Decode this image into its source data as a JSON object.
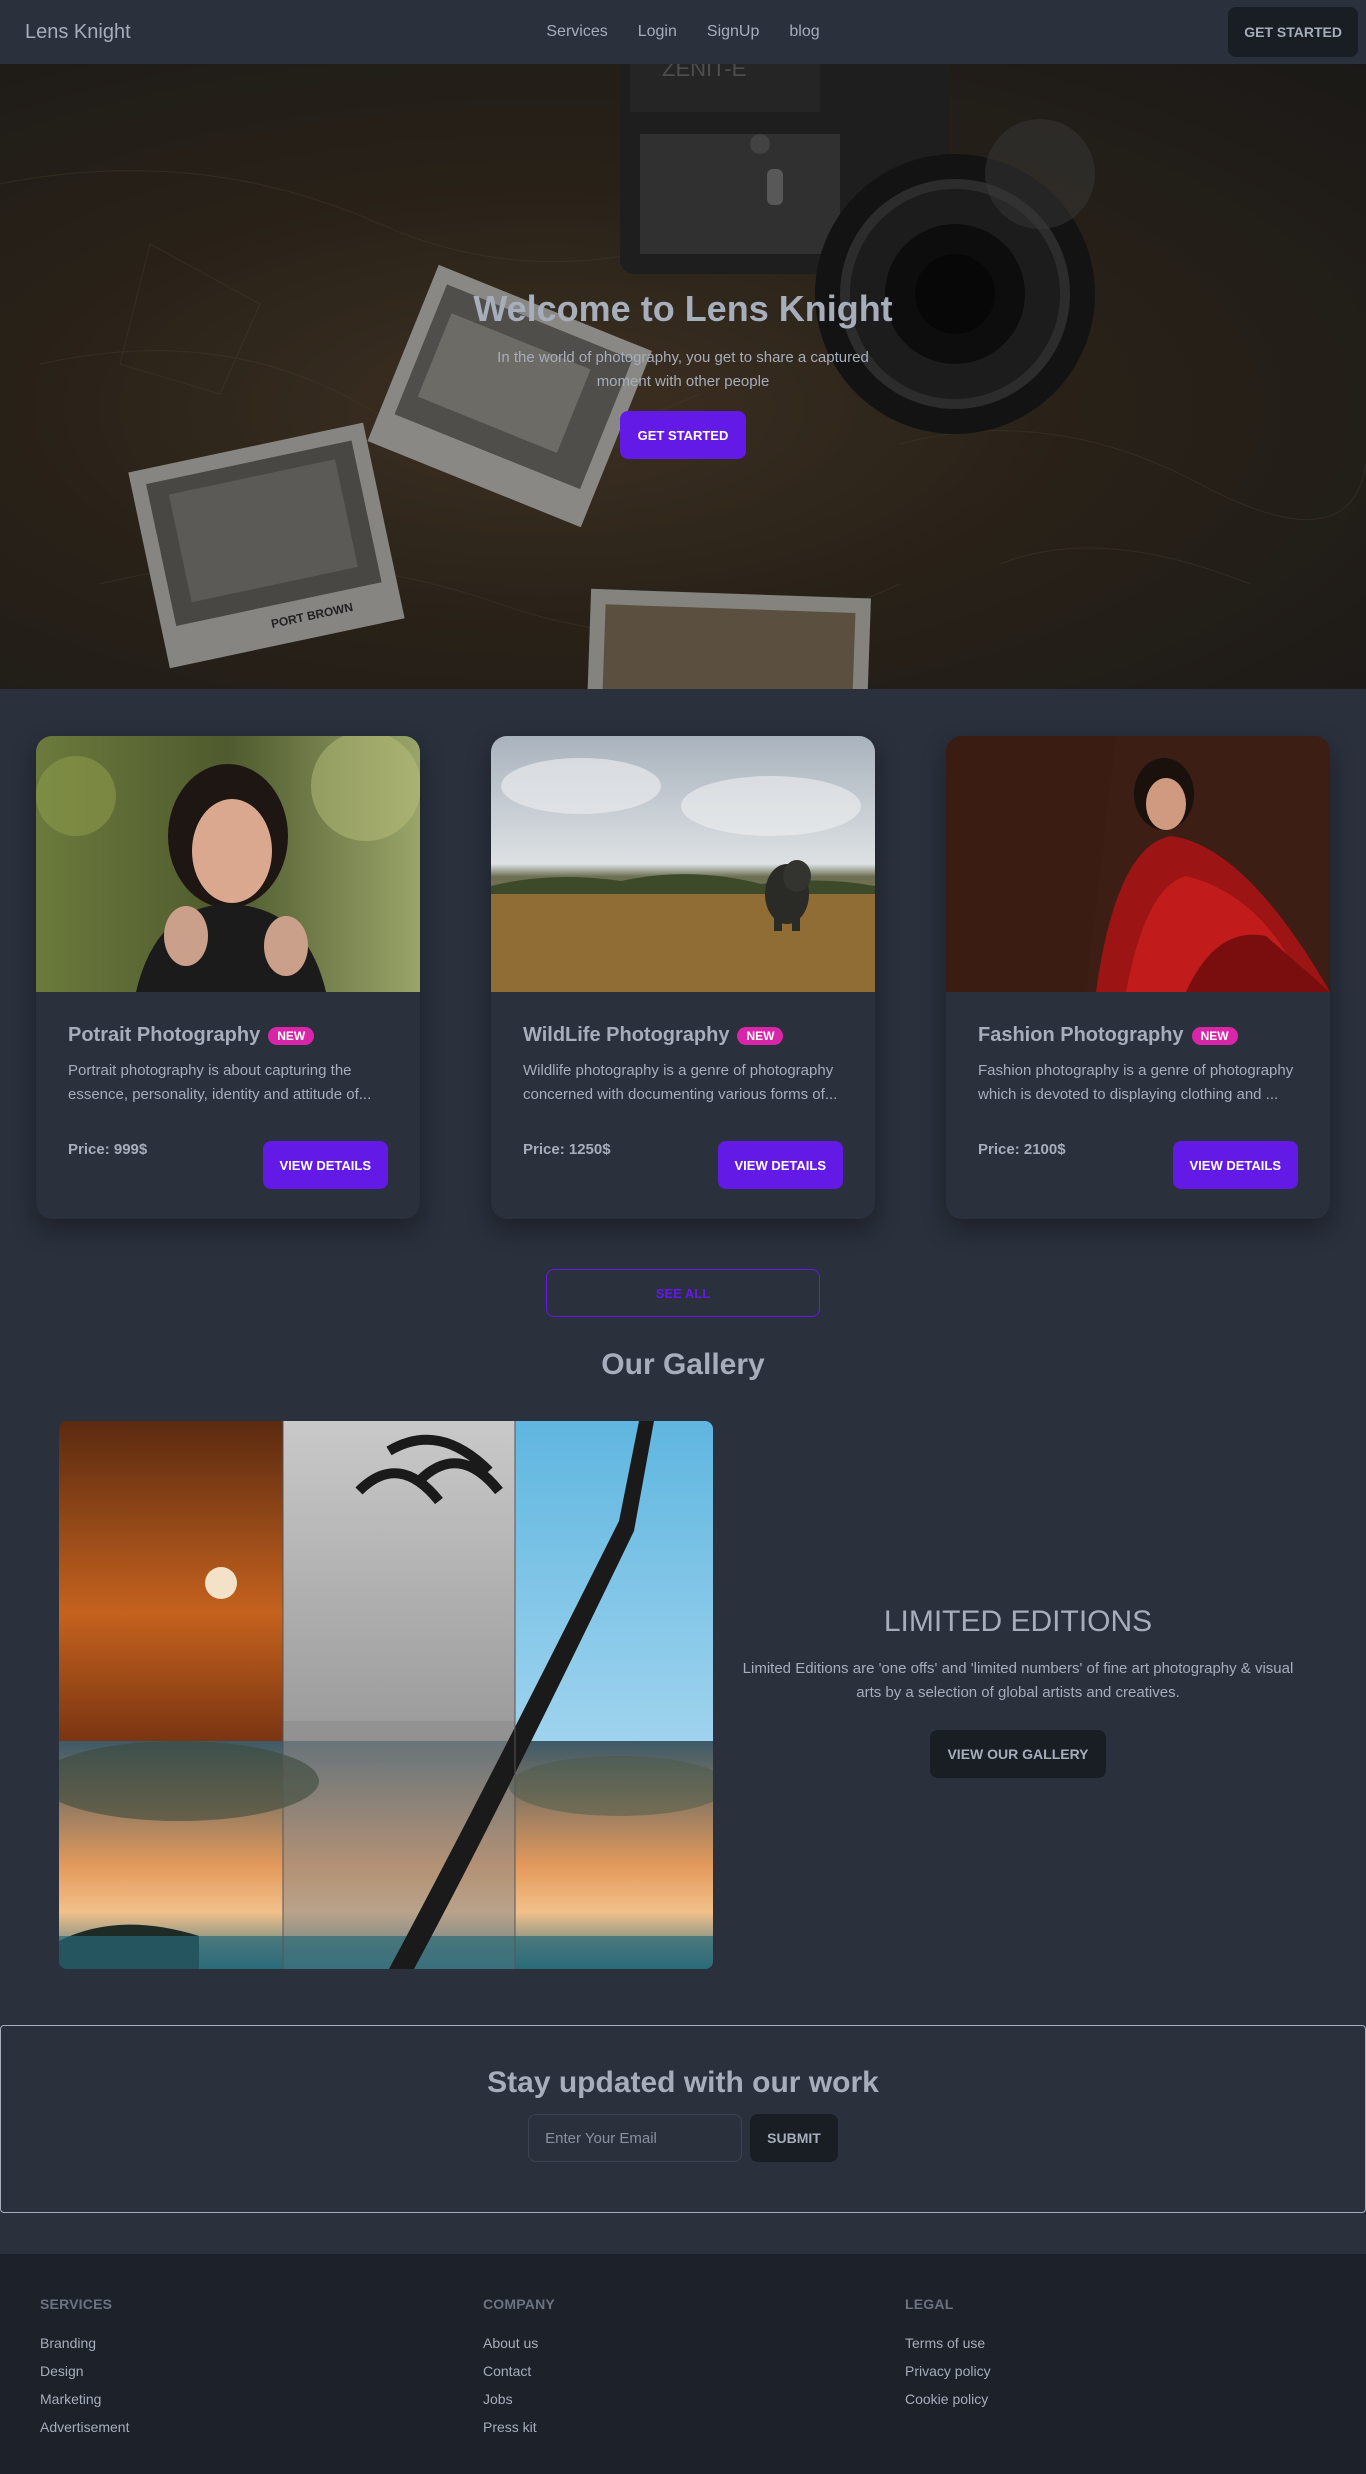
{
  "nav": {
    "brand": "Lens Knight",
    "links": [
      "Services",
      "Login",
      "SignUp",
      "blog"
    ],
    "cta": "GET STARTED"
  },
  "hero": {
    "title": "Welcome to Lens Knight",
    "subtitle": "In the world of photography, you get to share a captured moment with other people",
    "cta": "GET STARTED",
    "camera_text": "ZENIT-E",
    "photo_label": "PORT BROWN"
  },
  "cards": [
    {
      "title": "Potrait Photography",
      "badge": "NEW",
      "description": "Portrait photography is about capturing the essence, personality, identity and attitude of...",
      "price": "Price: 999$",
      "button": "VIEW DETAILS"
    },
    {
      "title": "WildLife Photography",
      "badge": "NEW",
      "description": "Wildlife photography is a genre of photography concerned with documenting various forms of...",
      "price": "Price: 1250$",
      "button": "VIEW DETAILS"
    },
    {
      "title": "Fashion Photography",
      "badge": "NEW",
      "description": "Fashion photography is a genre of photography which is devoted to displaying clothing and ...",
      "price": "Price: 2100$",
      "button": "VIEW DETAILS"
    }
  ],
  "see_all": "SEE ALL",
  "gallery": {
    "heading": "Our Gallery",
    "limited_title": "LIMITED EDITIONS",
    "limited_desc": "Limited Editions are 'one offs' and 'limited numbers' of fine art photography & visual arts by a selection of global artists and creatives.",
    "button": "VIEW OUR GALLERY"
  },
  "newsletter": {
    "title": "Stay updated with our work",
    "placeholder": "Enter Your Email",
    "button": "SUBMIT"
  },
  "footer": {
    "services": {
      "heading": "SERVICES",
      "links": [
        "Branding",
        "Design",
        "Marketing",
        "Advertisement"
      ]
    },
    "company": {
      "heading": "COMPANY",
      "links": [
        "About us",
        "Contact",
        "Jobs",
        "Press kit"
      ]
    },
    "legal": {
      "heading": "LEGAL",
      "links": [
        "Terms of use",
        "Privacy policy",
        "Cookie policy"
      ]
    }
  },
  "colors": {
    "background": "#2a303c",
    "primary": "#641ae6",
    "badge": "#d926a9",
    "dark_button": "#191d24",
    "footer": "#1d2129",
    "text": "#a6adbb"
  }
}
